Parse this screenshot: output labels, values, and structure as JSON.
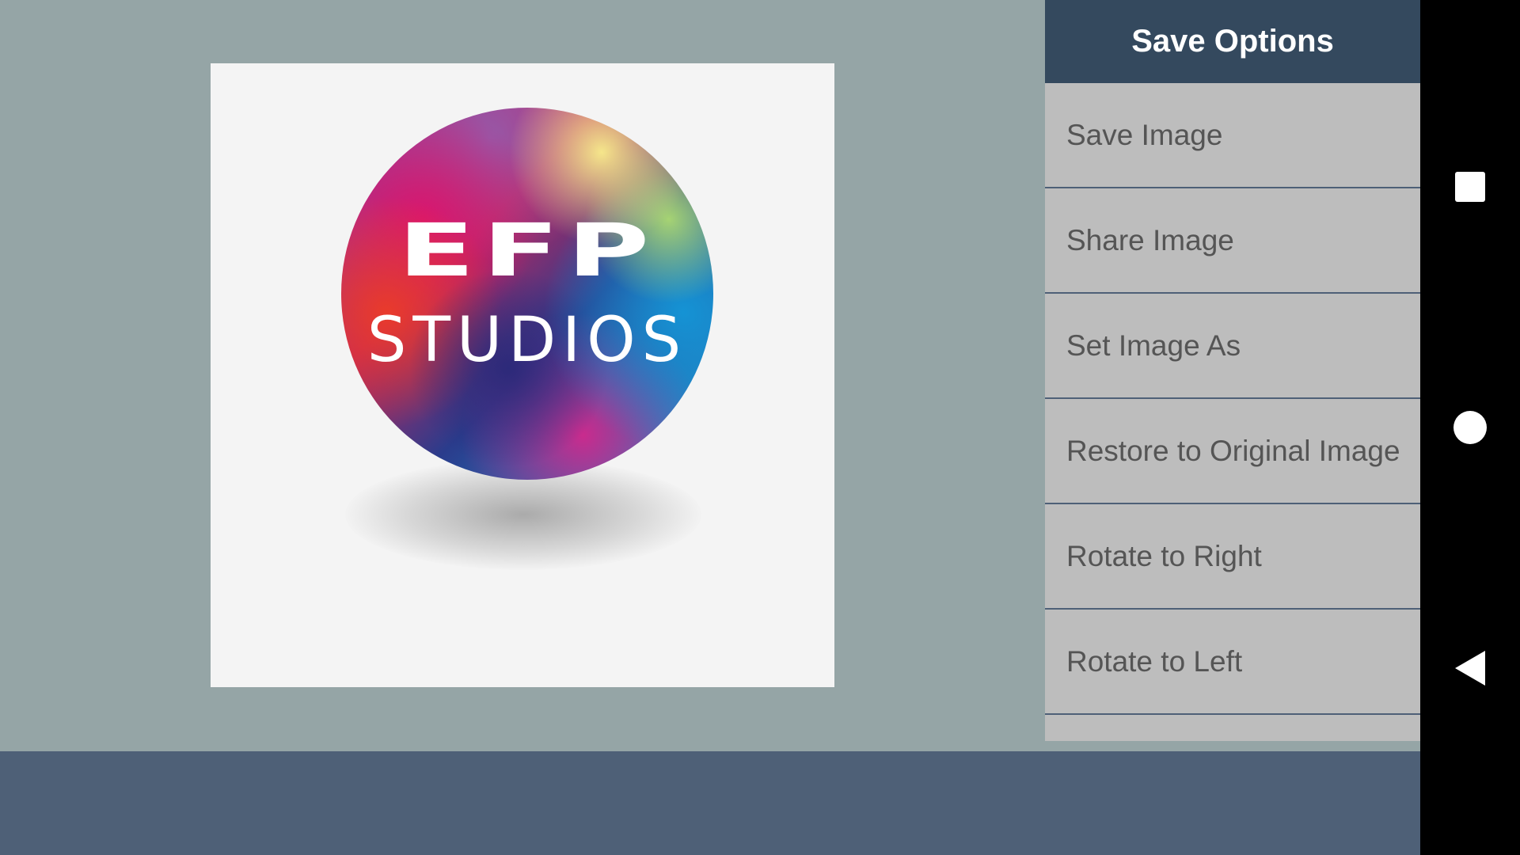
{
  "preview": {
    "logo_line1": "EFP",
    "logo_line2": "STUDIOS"
  },
  "menu": {
    "title": "Save Options",
    "items": [
      {
        "label": "Save Image"
      },
      {
        "label": "Share Image"
      },
      {
        "label": "Set Image As"
      },
      {
        "label": "Restore to Original Image"
      },
      {
        "label": "Rotate to Right"
      },
      {
        "label": "Rotate to Left"
      }
    ]
  },
  "nav": {
    "icons": [
      "recents-icon",
      "home-icon",
      "back-icon"
    ]
  },
  "colors": {
    "background": "#95A5A6",
    "menu_header": "#34495E",
    "menu_bg": "#BDBDBD",
    "bottom_bar": "#4E6077",
    "nav_bar": "#000000"
  }
}
